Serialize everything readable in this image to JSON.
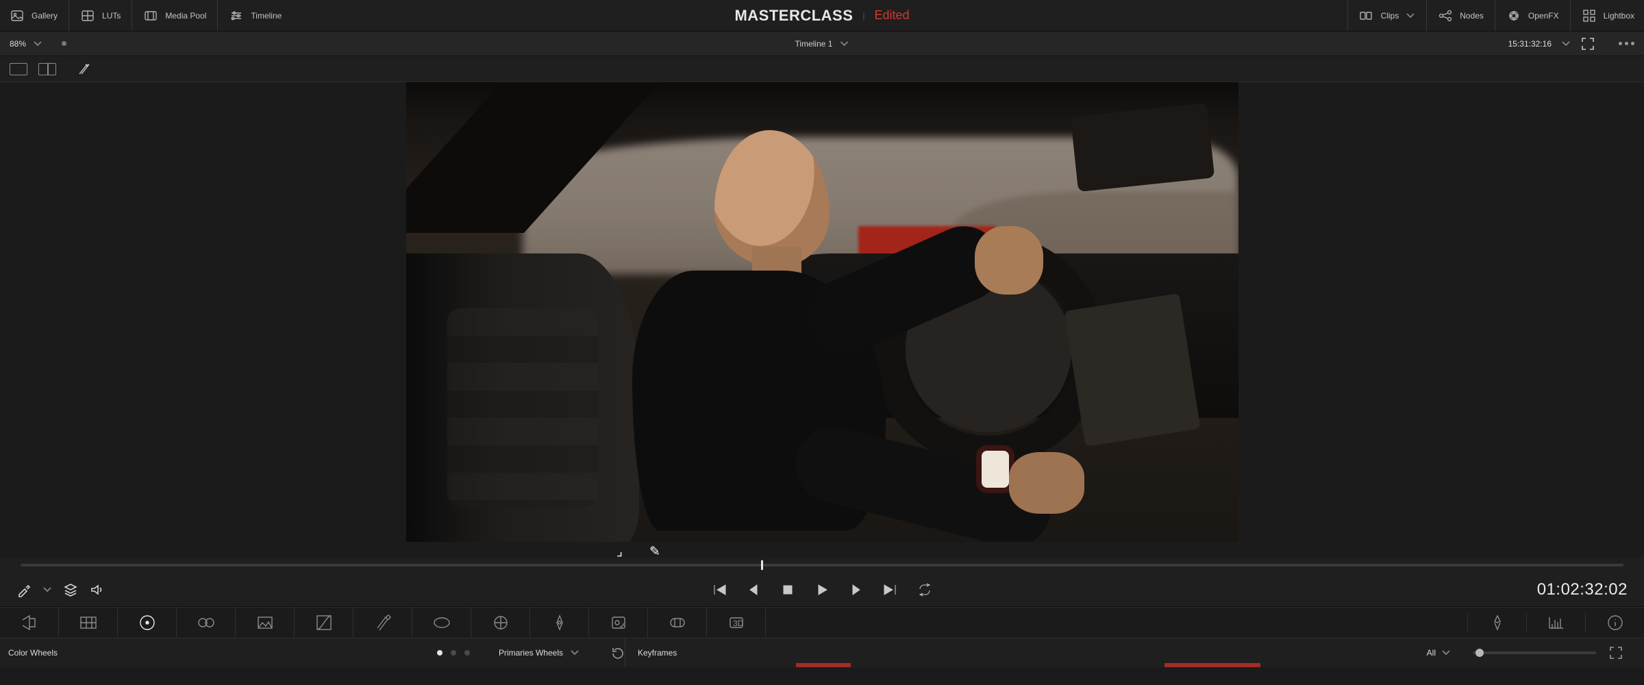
{
  "topbar": {
    "gallery": "Gallery",
    "luts": "LUTs",
    "media_pool": "Media Pool",
    "timeline": "Timeline",
    "project": "MASTERCLASS",
    "status": "Edited",
    "clips": "Clips",
    "nodes": "Nodes",
    "openfx": "OpenFX",
    "lightbox": "Lightbox"
  },
  "subbar": {
    "zoom": "88%",
    "timeline_name": "Timeline 1",
    "timecode": "15:31:32:16"
  },
  "transport": {
    "timecode": "01:02:32:02"
  },
  "footer": {
    "panel_label": "Color Wheels",
    "mode_label": "Primaries Wheels",
    "keyframes_label": "Keyframes",
    "filter_label": "All"
  },
  "icons": {
    "gallery": "gallery-icon",
    "luts": "luts-icon",
    "media_pool": "media-pool-icon",
    "timeline": "timeline-icon",
    "clips": "clips-icon",
    "nodes": "nodes-icon",
    "openfx": "openfx-icon",
    "lightbox": "lightbox-icon",
    "picker": "color-picker-icon",
    "stack": "layer-stack-icon",
    "mute": "mute-icon",
    "first": "first-frame-icon",
    "prev": "step-back-icon",
    "stop": "stop-icon",
    "play": "play-icon",
    "next": "step-fwd-icon",
    "last": "last-frame-icon",
    "loop": "loop-icon",
    "camera_raw": "camera-raw-icon",
    "color_match": "color-match-icon",
    "wheels": "color-wheels-icon",
    "rgb_mixer": "rgb-mixer-icon",
    "motion": "motion-effects-icon",
    "curves": "curves-icon",
    "qualifier": "qualifier-icon",
    "window": "power-window-icon",
    "tracker": "tracker-icon",
    "magic": "magic-mask-icon",
    "blur": "blur-icon",
    "key": "key-icon",
    "sizing": "sizing-icon",
    "stereo": "stereo-3d-icon",
    "highlight": "highlight-icon",
    "scopes": "scopes-icon",
    "info": "info-icon",
    "reset": "reset-icon",
    "expand": "expand-icon"
  }
}
